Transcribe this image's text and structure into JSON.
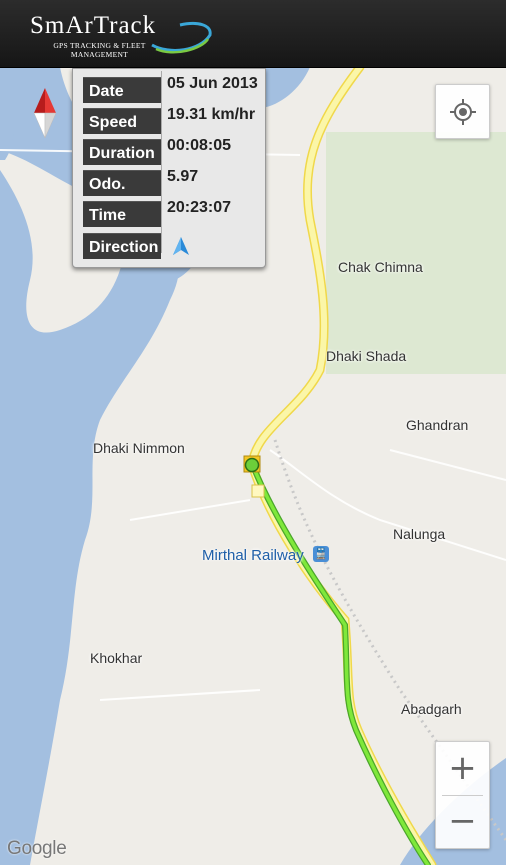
{
  "header": {
    "app_name": "SmArTrack",
    "tagline_line1": "GPS TRACKING & FLEET",
    "tagline_line2": "MANAGEMENT",
    "bg_color": "#1e1e1e",
    "accent_color": "#3aa7d8"
  },
  "info_panel": {
    "rows": [
      {
        "label": "Date",
        "value": "05 Jun 2013"
      },
      {
        "label": "Speed",
        "value": "19.31 km/hr"
      },
      {
        "label": "Duration",
        "value": "00:08:05"
      },
      {
        "label": "Odo.",
        "value": "5.97"
      },
      {
        "label": "Time",
        "value": "20:23:07"
      },
      {
        "label": "Direction",
        "value": "",
        "icon": "navigation-arrow-icon"
      }
    ]
  },
  "map": {
    "labels": {
      "chak_chimna": "Chak Chimna",
      "dhaki_shada": "Dhaki Shada",
      "ghandran": "Ghandran",
      "dhaki_nimmon": "Dhaki Nimmon",
      "nalunga": "Nalunga",
      "mirthal_railway": "Mirthal Railway",
      "khokhar": "Khokhar",
      "abadgarh": "Abadgarh"
    },
    "route_color": "#6ee02a",
    "road_color": "#f7ee8a",
    "water_color": "#a3bfe0",
    "park_color": "#dde8d2"
  },
  "controls": {
    "locate_icon": "crosshair-icon",
    "zoom_in": "+",
    "zoom_out": "−",
    "compass_icon": "compass-icon"
  },
  "attribution": "Google"
}
